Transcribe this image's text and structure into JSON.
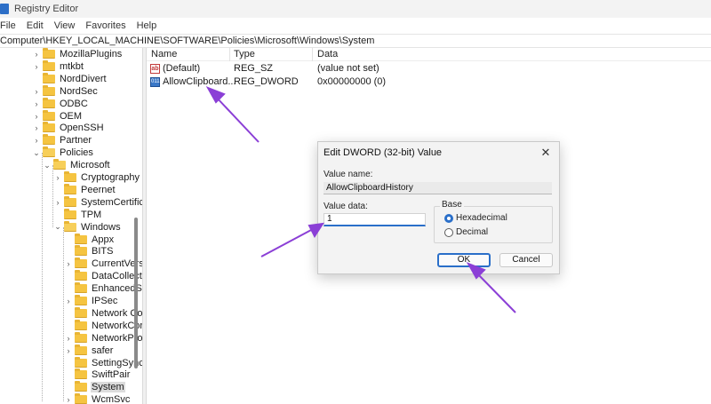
{
  "window": {
    "title": "Registry Editor"
  },
  "menu": [
    "File",
    "Edit",
    "View",
    "Favorites",
    "Help"
  ],
  "address": "Computer\\HKEY_LOCAL_MACHINE\\SOFTWARE\\Policies\\Microsoft\\Windows\\System",
  "tree": {
    "items": [
      {
        "label": "MozillaPlugins",
        "level": 0,
        "expander": "›",
        "selected": false
      },
      {
        "label": "mtkbt",
        "level": 0,
        "expander": "›",
        "selected": false
      },
      {
        "label": "NordDivert",
        "level": 0,
        "expander": "",
        "selected": false
      },
      {
        "label": "NordSec",
        "level": 0,
        "expander": "›",
        "selected": false
      },
      {
        "label": "ODBC",
        "level": 0,
        "expander": "›",
        "selected": false
      },
      {
        "label": "OEM",
        "level": 0,
        "expander": "›",
        "selected": false
      },
      {
        "label": "OpenSSH",
        "level": 0,
        "expander": "›",
        "selected": false
      },
      {
        "label": "Partner",
        "level": 0,
        "expander": "›",
        "selected": false
      },
      {
        "label": "Policies",
        "level": 0,
        "expander": "⌄",
        "selected": false
      },
      {
        "label": "Microsoft",
        "level": 1,
        "expander": "⌄",
        "selected": false
      },
      {
        "label": "Cryptography",
        "level": 2,
        "expander": "›",
        "selected": false
      },
      {
        "label": "Peernet",
        "level": 2,
        "expander": "",
        "selected": false
      },
      {
        "label": "SystemCertifica",
        "level": 2,
        "expander": "›",
        "selected": false
      },
      {
        "label": "TPM",
        "level": 2,
        "expander": "",
        "selected": false
      },
      {
        "label": "Windows",
        "level": 2,
        "expander": "⌄",
        "selected": false
      },
      {
        "label": "Appx",
        "level": 3,
        "expander": "",
        "selected": false
      },
      {
        "label": "BITS",
        "level": 3,
        "expander": "",
        "selected": false
      },
      {
        "label": "CurrentVersi",
        "level": 3,
        "expander": "›",
        "selected": false
      },
      {
        "label": "DataCollect",
        "level": 3,
        "expander": "",
        "selected": false
      },
      {
        "label": "EnhancedSt",
        "level": 3,
        "expander": "",
        "selected": false
      },
      {
        "label": "IPSec",
        "level": 3,
        "expander": "›",
        "selected": false
      },
      {
        "label": "Network Co",
        "level": 3,
        "expander": "",
        "selected": false
      },
      {
        "label": "NetworkCor",
        "level": 3,
        "expander": "",
        "selected": false
      },
      {
        "label": "NetworkPro",
        "level": 3,
        "expander": "›",
        "selected": false
      },
      {
        "label": "safer",
        "level": 3,
        "expander": "›",
        "selected": false
      },
      {
        "label": "SettingSync",
        "level": 3,
        "expander": "",
        "selected": false
      },
      {
        "label": "SwiftPair",
        "level": 3,
        "expander": "",
        "selected": false
      },
      {
        "label": "System",
        "level": 3,
        "expander": "",
        "selected": true
      },
      {
        "label": "WcmSvc",
        "level": 3,
        "expander": "›",
        "selected": false
      }
    ]
  },
  "list": {
    "columns": [
      "Name",
      "Type",
      "Data"
    ],
    "rows": [
      {
        "icon": "string-value-icon",
        "icon_text": "ab",
        "name": "(Default)",
        "type": "REG_SZ",
        "data": "(value not set)"
      },
      {
        "icon": "dword-value-icon",
        "icon_text": "011",
        "name": "AllowClipboard...",
        "type": "REG_DWORD",
        "data": "0x00000000 (0)"
      }
    ]
  },
  "dialog": {
    "title": "Edit DWORD (32-bit) Value",
    "close_glyph": "✕",
    "value_name_label": "Value name:",
    "value_name": "AllowClipboardHistory",
    "value_data_label": "Value data:",
    "value_data": "1",
    "base_label": "Base",
    "base_options": [
      {
        "label": "Hexadecimal",
        "checked": true
      },
      {
        "label": "Decimal",
        "checked": false
      }
    ],
    "ok_label": "OK",
    "cancel_label": "Cancel"
  },
  "colors": {
    "annotation_arrow": "#8b3fd6",
    "accent": "#2a6fc9"
  }
}
